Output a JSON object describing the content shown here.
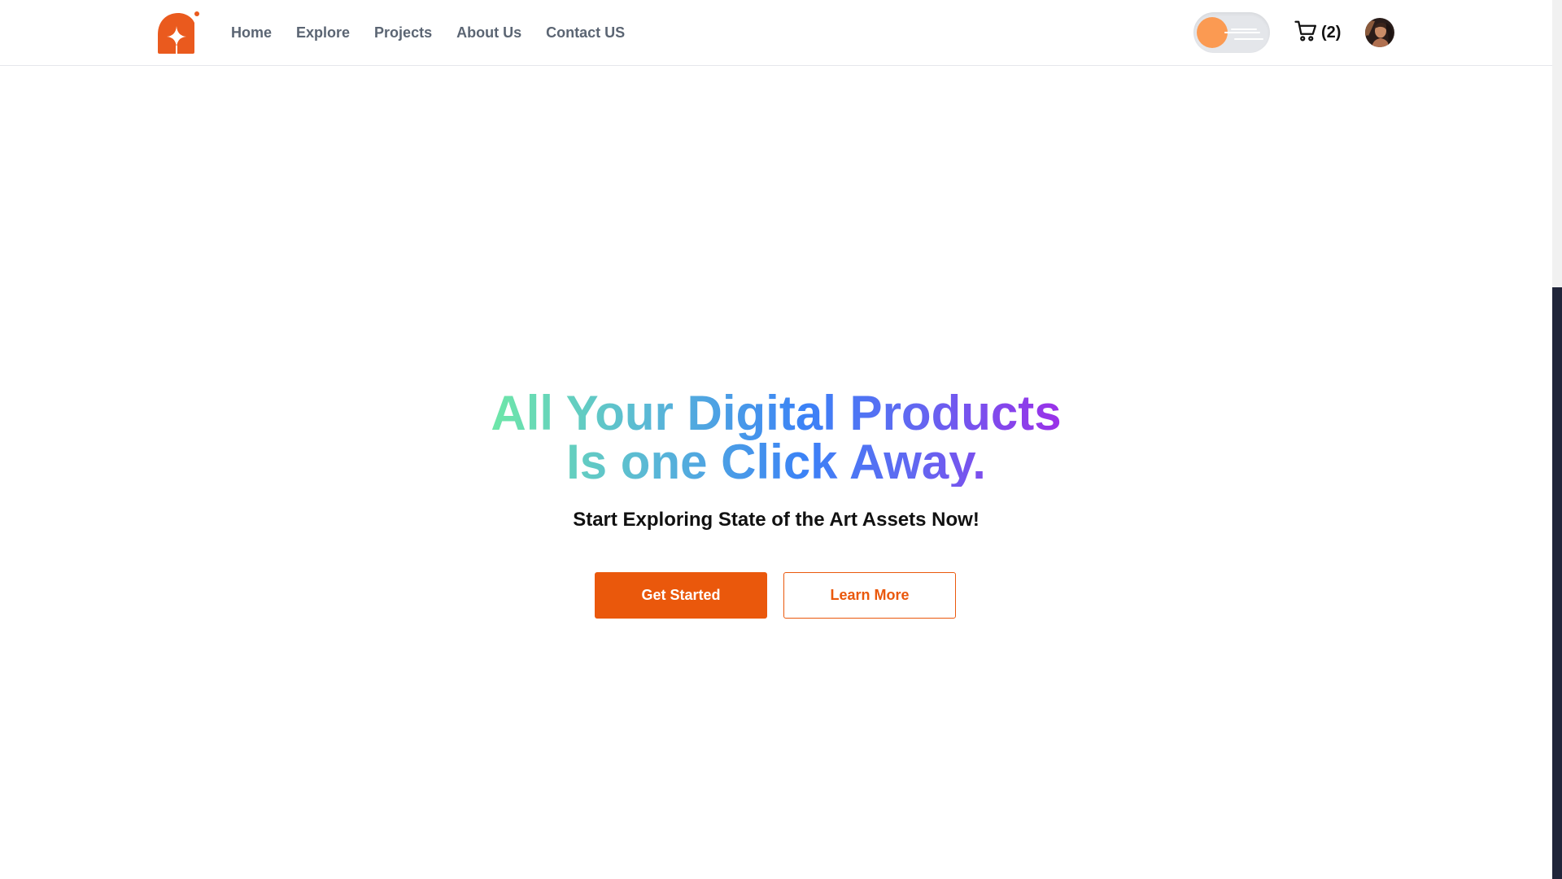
{
  "header": {
    "logo_icon": "sparkle-logo-icon",
    "nav": [
      {
        "label": "Home"
      },
      {
        "label": "Explore"
      },
      {
        "label": "Projects"
      },
      {
        "label": "About Us"
      },
      {
        "label": "Contact US"
      }
    ],
    "theme_toggle": {
      "state": "light",
      "knob_color": "#fb9a52"
    },
    "cart": {
      "icon": "cart-icon",
      "count_label": "(2)"
    },
    "avatar_icon": "user-avatar"
  },
  "hero": {
    "headline_line1": "All Your Digital Products",
    "headline_line2": "Is one Click Away.",
    "headline_gradient": [
      "#6ee7a8",
      "#5ab8d6",
      "#3b82f6",
      "#6366f1",
      "#9b30e8"
    ],
    "subtitle": "Start Exploring State of the Art Assets Now!",
    "primary_button": "Get Started",
    "secondary_button": "Learn More"
  },
  "colors": {
    "accent": "#ea580c",
    "nav_text": "#5b6573",
    "scrollbar_thumb": "#20253a"
  }
}
